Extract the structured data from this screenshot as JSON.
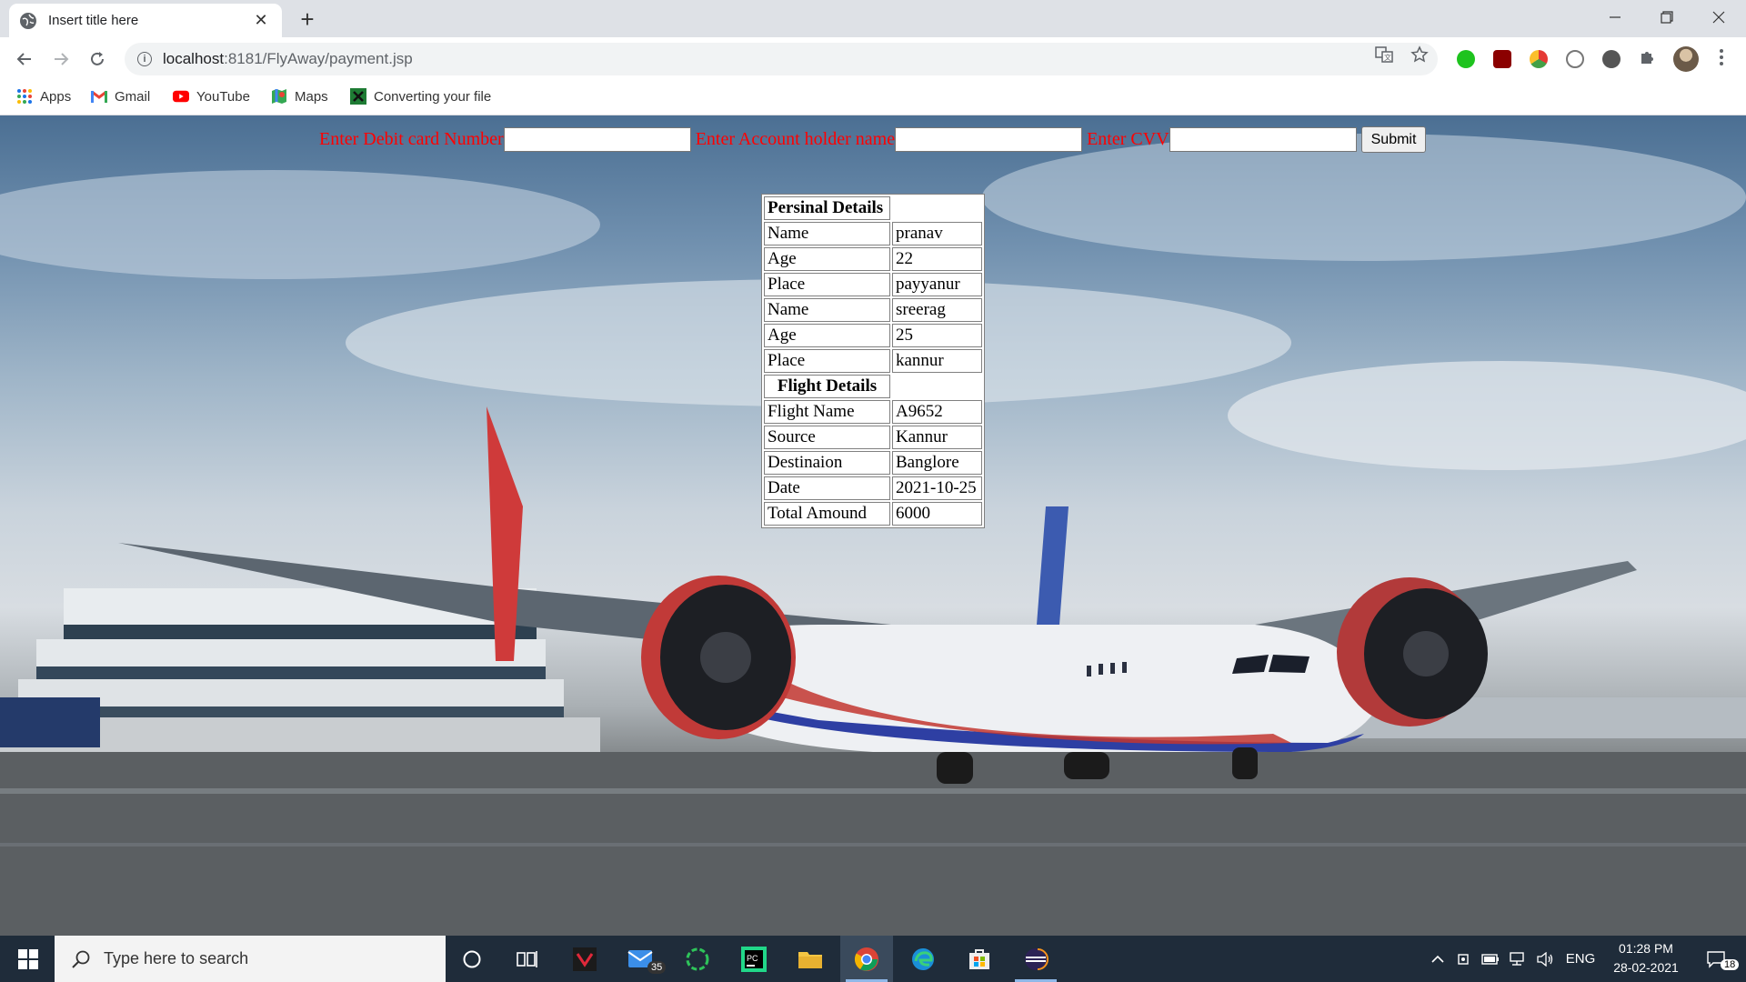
{
  "browser": {
    "tab_title": "Insert title here",
    "url_host": "localhost",
    "url_path": ":8181/FlyAway/payment.jsp",
    "bookmarks": [
      {
        "label": "Apps",
        "icon": "apps-grid-icon"
      },
      {
        "label": "Gmail",
        "icon": "gmail-icon"
      },
      {
        "label": "YouTube",
        "icon": "youtube-icon"
      },
      {
        "label": "Maps",
        "icon": "maps-icon"
      },
      {
        "label": "Converting your file",
        "icon": "converter-icon"
      }
    ]
  },
  "form": {
    "card_label": "Enter Debit card Number",
    "card_value": "",
    "holder_label": "Enter Account holder name",
    "holder_value": "",
    "cvv_label": "Enter CVV",
    "cvv_value": "",
    "submit_label": "Submit"
  },
  "details": {
    "personal_header": "Persinal Details",
    "passengers": [
      {
        "name_label": "Name",
        "name": "pranav",
        "age_label": "Age",
        "age": "22",
        "place_label": "Place",
        "place": "payyanur"
      },
      {
        "name_label": "Name",
        "name": "sreerag",
        "age_label": "Age",
        "age": "25",
        "place_label": "Place",
        "place": "kannur"
      }
    ],
    "flight_header": "Flight Details",
    "flight": [
      {
        "label": "Flight Name",
        "value": "A9652"
      },
      {
        "label": "Source",
        "value": "Kannur"
      },
      {
        "label": "Destinaion",
        "value": "Banglore"
      },
      {
        "label": "Date",
        "value": "2021-10-25"
      },
      {
        "label": "Total Amound",
        "value": "6000"
      }
    ]
  },
  "taskbar": {
    "search_placeholder": "Type here to search",
    "mail_badge": "35",
    "language": "ENG",
    "time": "01:28 PM",
    "date": "28-02-2021",
    "notification_count": "18"
  },
  "colors": {
    "form_label": "#ff0000",
    "taskbar": "#1f2c3a",
    "tabstrip": "#dee1e6"
  }
}
